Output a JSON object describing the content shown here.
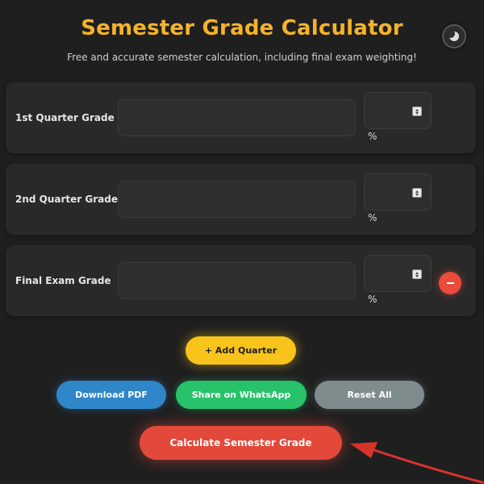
{
  "header": {
    "title": "Semester Grade Calculator",
    "subtitle": "Free and accurate semester calculation, including final exam weighting!"
  },
  "rows": [
    {
      "label": "1st Quarter Grade",
      "grade_value": "",
      "weight_value": "",
      "unit": "%"
    },
    {
      "label": "2nd Quarter Grade",
      "grade_value": "",
      "weight_value": "",
      "unit": "%"
    },
    {
      "label": "Final Exam Grade",
      "grade_value": "",
      "weight_value": "",
      "unit": "%"
    }
  ],
  "actions": {
    "add_quarter": "+ Add Quarter",
    "download_pdf": "Download PDF",
    "share_whatsapp": "Share on WhatsApp",
    "reset_all": "Reset All",
    "calculate": "Calculate Semester Grade"
  },
  "icons": {
    "theme_toggle": "moon-icon",
    "remove_row": "minus-icon",
    "annotation": "arrow-icon"
  },
  "colors": {
    "background": "#1f1f1f",
    "title": "#f5b32a",
    "add_button": "#f8c41c",
    "pdf_button": "#2f86c9",
    "whatsapp_button": "#27c26a",
    "reset_button": "#7f8c8d",
    "calculate_button": "#e2493a",
    "remove_button": "#e74c3c",
    "annotation_arrow": "#d8332b"
  }
}
